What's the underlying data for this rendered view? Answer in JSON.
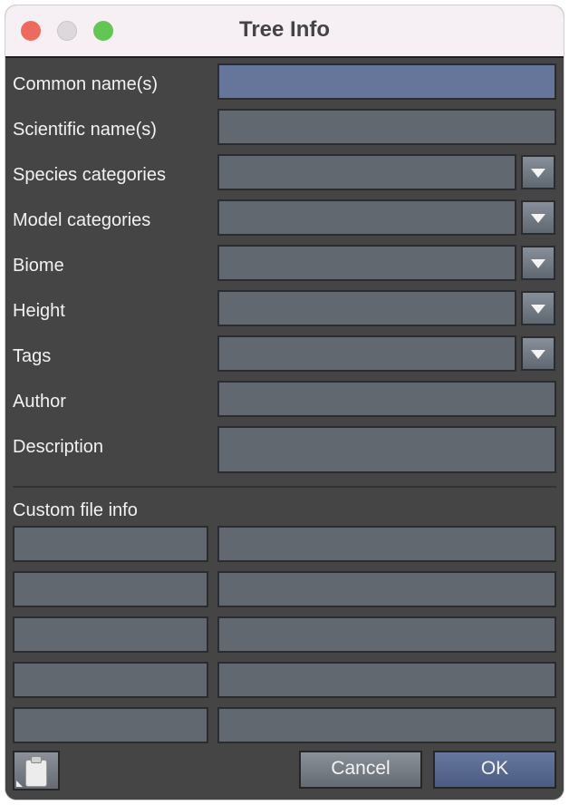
{
  "window": {
    "title": "Tree Info",
    "controls": [
      "close",
      "minimize",
      "maximize"
    ]
  },
  "form": {
    "fields": [
      {
        "label": "Common name(s)",
        "value": "",
        "type": "text",
        "focused": true
      },
      {
        "label": "Scientific name(s)",
        "value": "",
        "type": "text"
      },
      {
        "label": "Species categories",
        "value": "",
        "type": "dropdown"
      },
      {
        "label": "Model categories",
        "value": "",
        "type": "dropdown"
      },
      {
        "label": "Biome",
        "value": "",
        "type": "dropdown"
      },
      {
        "label": "Height",
        "value": "",
        "type": "dropdown"
      },
      {
        "label": "Tags",
        "value": "",
        "type": "dropdown"
      },
      {
        "label": "Author",
        "value": "",
        "type": "text"
      },
      {
        "label": "Description",
        "value": "",
        "type": "textarea"
      }
    ]
  },
  "custom_file_info": {
    "heading": "Custom file info",
    "rows": [
      {
        "key": "",
        "value": ""
      },
      {
        "key": "",
        "value": ""
      },
      {
        "key": "",
        "value": ""
      },
      {
        "key": "",
        "value": ""
      },
      {
        "key": "",
        "value": ""
      }
    ]
  },
  "footer": {
    "clipboard_icon": "clipboard-icon",
    "cancel_label": "Cancel",
    "ok_label": "OK"
  },
  "colors": {
    "panel_bg": "#454545",
    "field_bg": "#616870",
    "focused_field_bg": "#66769a",
    "ok_button": "#5a6a92",
    "titlebar_bg": "#f6f0f5"
  }
}
